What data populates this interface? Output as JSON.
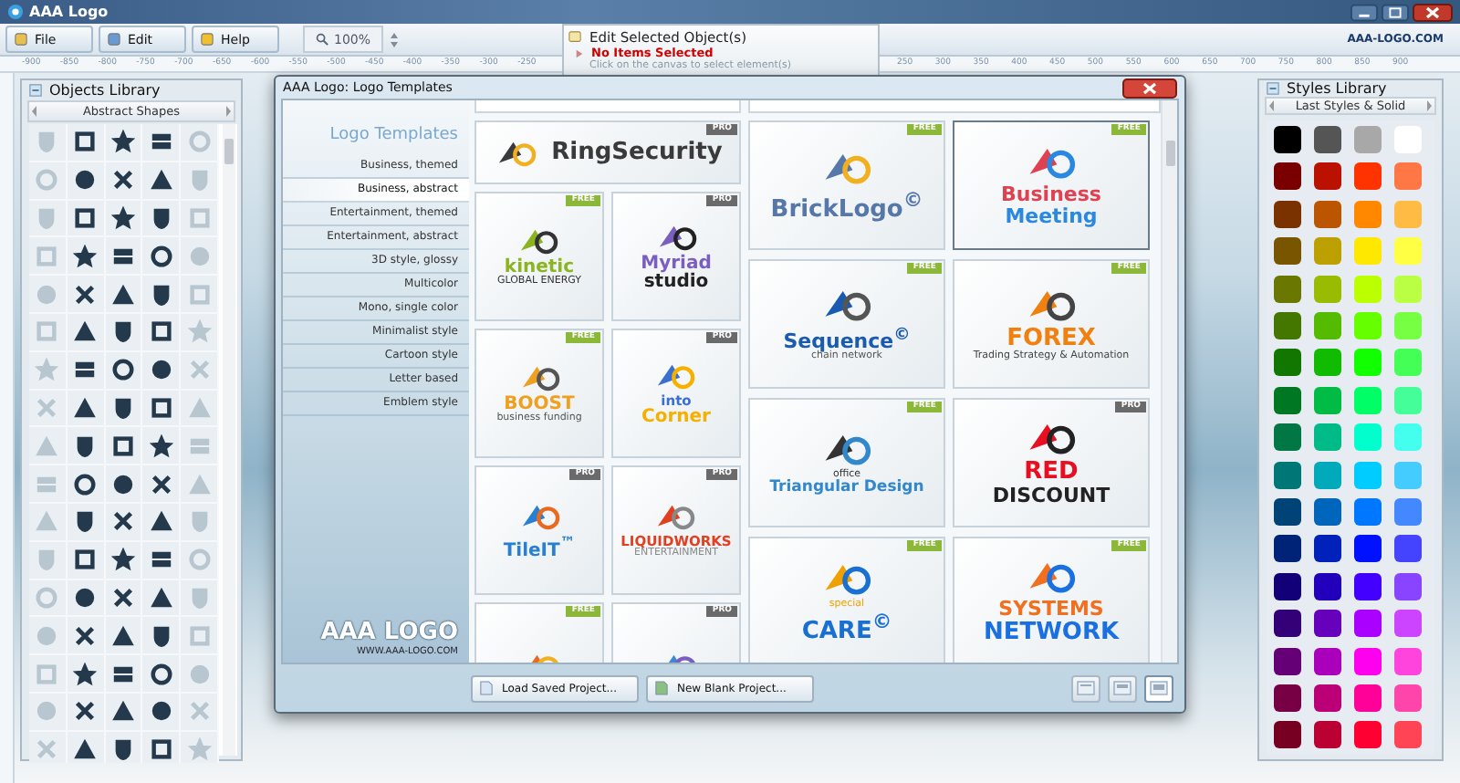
{
  "window": {
    "title": "AAA Logo"
  },
  "toolbar": {
    "buttons": [
      {
        "label": "File",
        "kind": "file"
      },
      {
        "label": "Edit",
        "kind": "edit"
      },
      {
        "label": "Help",
        "kind": "help"
      }
    ],
    "zoom": "100%",
    "site": "AAA-LOGO.COM"
  },
  "ruler": {
    "left_labels": [
      "-900",
      "-850",
      "-800",
      "-750",
      "-700",
      "-650",
      "-600",
      "-550",
      "-500",
      "-450",
      "-400",
      "-350",
      "-300",
      "-250"
    ],
    "right_labels": [
      "250",
      "300",
      "350",
      "400",
      "450",
      "500",
      "550",
      "600",
      "650",
      "700",
      "750",
      "800",
      "850",
      "900"
    ]
  },
  "edit_panel": {
    "title": "Edit Selected Object(s)",
    "status": "No Items Selected",
    "hint": "Click on the canvas to select element(s)"
  },
  "objects_library": {
    "title": "Objects Library",
    "category": "Abstract Shapes"
  },
  "styles_library": {
    "title": "Styles Library",
    "category": "Last Styles & Solid",
    "swatches": [
      {
        "color": "#000000"
      },
      {
        "color": "#555555"
      },
      {
        "color": "#a8a8a8"
      },
      {
        "color": "#ffffff"
      },
      {
        "color": "#7a0000"
      },
      {
        "color": "#bb1100"
      },
      {
        "color": "#ff3300"
      },
      {
        "color": "#ff7744"
      },
      {
        "color": "#7a3300"
      },
      {
        "color": "#bb5500"
      },
      {
        "color": "#ff8800"
      },
      {
        "color": "#ffbb44"
      },
      {
        "color": "#7a5500"
      },
      {
        "color": "#bba000"
      },
      {
        "color": "#ffe800"
      },
      {
        "color": "#ffff44"
      },
      {
        "color": "#6a7700"
      },
      {
        "color": "#99bb00"
      },
      {
        "color": "#bbff00"
      },
      {
        "color": "#bbff44"
      },
      {
        "color": "#447700"
      },
      {
        "color": "#55bb00"
      },
      {
        "color": "#66ff00"
      },
      {
        "color": "#77ff44"
      },
      {
        "color": "#117700"
      },
      {
        "color": "#11bb00"
      },
      {
        "color": "#11ff00"
      },
      {
        "color": "#44ff55"
      },
      {
        "color": "#007722"
      },
      {
        "color": "#00bb44"
      },
      {
        "color": "#00ff66"
      },
      {
        "color": "#44ff99"
      },
      {
        "color": "#007744"
      },
      {
        "color": "#00bb88"
      },
      {
        "color": "#00ffcc"
      },
      {
        "color": "#44ffee"
      },
      {
        "color": "#007777"
      },
      {
        "color": "#00aabb"
      },
      {
        "color": "#00ccff"
      },
      {
        "color": "#44ccff"
      },
      {
        "color": "#004477"
      },
      {
        "color": "#0066bb"
      },
      {
        "color": "#0077ff"
      },
      {
        "color": "#4488ff"
      },
      {
        "color": "#002277"
      },
      {
        "color": "#0022bb"
      },
      {
        "color": "#0011ff"
      },
      {
        "color": "#4444ff"
      },
      {
        "color": "#110077"
      },
      {
        "color": "#2200bb"
      },
      {
        "color": "#4400ff"
      },
      {
        "color": "#8844ff"
      },
      {
        "color": "#330077"
      },
      {
        "color": "#6600bb"
      },
      {
        "color": "#aa00ff"
      },
      {
        "color": "#cc44ff"
      },
      {
        "color": "#660077"
      },
      {
        "color": "#aa00bb"
      },
      {
        "color": "#ff00ee"
      },
      {
        "color": "#ff44dd"
      },
      {
        "color": "#770044"
      },
      {
        "color": "#bb0077"
      },
      {
        "color": "#ff0099"
      },
      {
        "color": "#ff44aa"
      },
      {
        "color": "#770022"
      },
      {
        "color": "#bb0033"
      },
      {
        "color": "#ff0033"
      },
      {
        "color": "#ff4455"
      }
    ]
  },
  "dialog": {
    "title": "AAA Logo: Logo Templates",
    "heading": "Logo Templates",
    "categories": [
      {
        "label": "Business, themed",
        "selected": false
      },
      {
        "label": "Business, abstract",
        "selected": true
      },
      {
        "label": "Entertainment, themed",
        "selected": false
      },
      {
        "label": "Entertainment, abstract",
        "selected": false
      },
      {
        "label": "3D style, glossy",
        "selected": false
      },
      {
        "label": "Multicolor",
        "selected": false
      },
      {
        "label": "Mono, single color",
        "selected": false
      },
      {
        "label": "Minimalist style",
        "selected": false
      },
      {
        "label": "Cartoon style",
        "selected": false
      },
      {
        "label": "Letter based",
        "selected": false
      },
      {
        "label": "Emblem style",
        "selected": false
      }
    ],
    "brand": "AAA LOGO",
    "brand_url": "WWW.AAA-LOGO.COM",
    "featured": {
      "badge": "PRO",
      "kind": "pro",
      "selected": false,
      "lines": [
        {
          "text": "RingSecurity",
          "kind": "large",
          "color": "#3a3a3a"
        }
      ]
    },
    "small_templates": [
      {
        "badge": "FREE",
        "kind": "free",
        "selected": false,
        "lines": [
          {
            "text": "kinetic",
            "kind": "medium",
            "color": "#8ab420"
          },
          {
            "text": "GLOBAL ENERGY",
            "kind": "small",
            "color": "#333333"
          }
        ]
      },
      {
        "badge": "PRO",
        "kind": "pro",
        "selected": false,
        "lines": [
          {
            "text": "Myriad",
            "kind": "medium",
            "color": "#7a5fc0"
          },
          {
            "text": "studio",
            "kind": "medium",
            "color": "#222222"
          }
        ]
      },
      {
        "badge": "FREE",
        "kind": "free",
        "selected": false,
        "lines": [
          {
            "text": "BOOST",
            "kind": "medium",
            "color": "#f0a020"
          },
          {
            "text": "business funding",
            "kind": "small",
            "color": "#555555"
          }
        ]
      },
      {
        "badge": "PRO",
        "kind": "pro",
        "selected": false,
        "lines": [
          {
            "text": "into",
            "kind": "compact",
            "color": "#3a6fd0"
          },
          {
            "text": "Corner",
            "kind": "medium",
            "color": "#f5b000"
          }
        ]
      },
      {
        "badge": "PRO",
        "kind": "pro",
        "selected": false,
        "lines": [
          {
            "text": "TileIT$^{™}$",
            "kind": "medium",
            "color": "#2a80d0"
          }
        ]
      },
      {
        "badge": "PRO",
        "kind": "pro",
        "selected": false,
        "lines": [
          {
            "text": "LIQUIDWORKS",
            "kind": "compact",
            "color": "#e04020"
          },
          {
            "text": "ENTERTAINMENT",
            "kind": "small",
            "color": "#888888"
          }
        ]
      },
      {
        "badge": "FREE",
        "kind": "free",
        "selected": false
      },
      {
        "badge": "PRO",
        "kind": "pro",
        "selected": false
      }
    ],
    "large_templates": [
      {
        "badge": "FREE",
        "kind": "free",
        "selected": false,
        "lines": [
          {
            "text": "BrickLogo$^{©}$",
            "kind": "large",
            "color": "#5577aa"
          }
        ]
      },
      {
        "badge": "FREE",
        "kind": "free",
        "selected": true,
        "lines": [
          {
            "text": "Business",
            "kind": "medium",
            "color": "#e04050"
          },
          {
            "text": "Meeting",
            "kind": "medium",
            "color": "#2a88e0"
          }
        ]
      },
      {
        "badge": "FREE",
        "kind": "free",
        "selected": false,
        "lines": [
          {
            "text": "Sequence$^{©}$",
            "kind": "medium",
            "color": "#1a5bb0"
          },
          {
            "text": "chain network",
            "kind": "small",
            "color": "#555555"
          }
        ]
      },
      {
        "badge": "FREE",
        "kind": "free",
        "selected": false,
        "lines": [
          {
            "text": "FOREX",
            "kind": "large",
            "color": "#f08010"
          },
          {
            "text": "Trading Strategy & Automation",
            "kind": "small",
            "color": "#444444"
          }
        ]
      },
      {
        "badge": "FREE",
        "kind": "free",
        "selected": false,
        "lines": [
          {
            "text": "office",
            "kind": "small",
            "color": "#333333"
          },
          {
            "text": "Triangular Design",
            "kind": "compact",
            "color": "#3388cc"
          }
        ]
      },
      {
        "badge": "PRO",
        "kind": "pro",
        "selected": false,
        "lines": [
          {
            "text": "RED",
            "kind": "large",
            "color": "#e81020"
          },
          {
            "text": "DISCOUNT",
            "kind": "medium",
            "color": "#222222"
          }
        ]
      },
      {
        "badge": "FREE",
        "kind": "free",
        "selected": false,
        "lines": [
          {
            "text": "special",
            "kind": "small",
            "color": "#f0a000"
          },
          {
            "text": "CARE$^{©}$",
            "kind": "large",
            "color": "#1a70d0"
          }
        ]
      },
      {
        "badge": "FREE",
        "kind": "free",
        "selected": false,
        "lines": [
          {
            "text": "SYSTEMS",
            "kind": "medium",
            "color": "#f07020"
          },
          {
            "text": "NETWORK",
            "kind": "large",
            "color": "#1a70e0"
          }
        ]
      }
    ],
    "buttons": [
      {
        "label": "Load Saved Project...",
        "kind": "load"
      },
      {
        "label": "New Blank Project...",
        "kind": "new"
      }
    ],
    "view_buttons": [
      {
        "selected": false
      },
      {
        "selected": false
      },
      {
        "selected": true
      }
    ]
  }
}
